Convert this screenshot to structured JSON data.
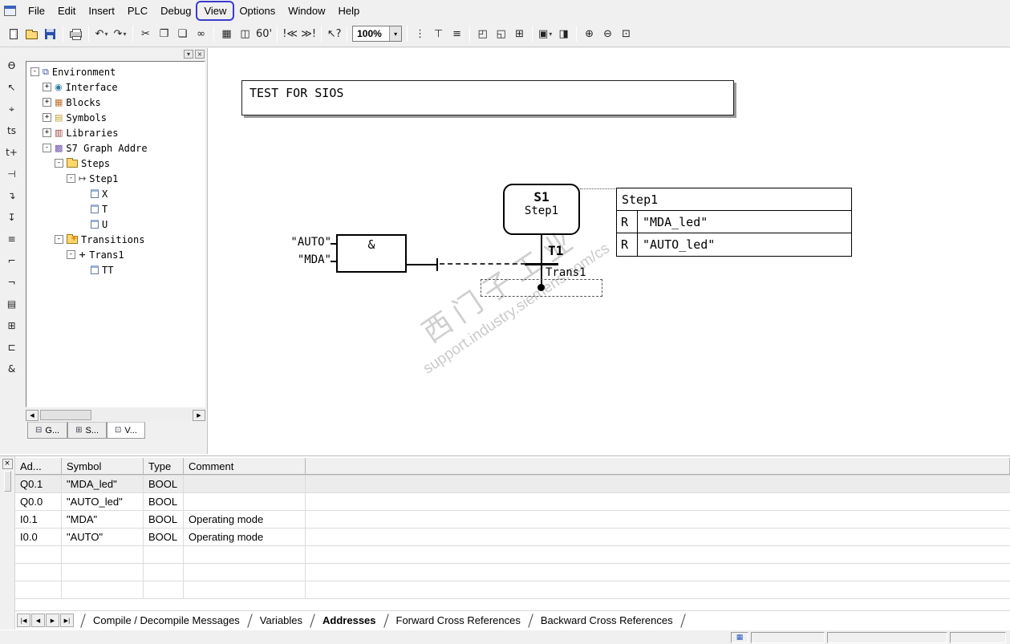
{
  "menu": {
    "items": [
      "File",
      "Edit",
      "Insert",
      "PLC",
      "Debug",
      "View",
      "Options",
      "Window",
      "Help"
    ]
  },
  "toolbar": {
    "dropdown": "▾",
    "undo": "↶",
    "redo": "↷",
    "cut": "✂",
    "copy": "❐",
    "paste": "❏",
    "find": "∞",
    "detail_view": "▦",
    "block_properties": "◫",
    "monitor_glasses": "60'",
    "prev_error": "!≪",
    "next_error": "≫!",
    "context_help": "↖?",
    "zoom_value": "100%",
    "sequence_view": "⋮",
    "single_step_view": "⊤",
    "overview": "≡",
    "show_symbols": "◰",
    "show_comments": "◱",
    "show_conditions": "⊞",
    "display_options": "▣",
    "display_bright": "◨",
    "zoom_in": "⊕",
    "zoom_out": "⊖",
    "zoom_fit": "⊡"
  },
  "left_toolbar": {
    "buttons": [
      "Ѳ",
      "↖",
      "⌖",
      "ts",
      "t+",
      "⊣",
      "↴",
      "↧",
      "≡",
      "⌐",
      "¬",
      "▤",
      "⊞",
      "⊏",
      "&"
    ]
  },
  "icons": {
    "environment": "⧉",
    "interface": "◉",
    "blocks": "▦",
    "symbols": "▤",
    "libraries": "▥",
    "s7graph": "▩",
    "step": "↦",
    "transition": "+"
  },
  "tree": {
    "controls": {
      "dropdown": "▾",
      "close": "×"
    },
    "items": [
      {
        "label": "Environment",
        "expander": "-"
      },
      {
        "label": "Interface",
        "expander": "+"
      },
      {
        "label": "Blocks",
        "expander": "+"
      },
      {
        "label": "Symbols",
        "expander": "+"
      },
      {
        "label": "Libraries",
        "expander": "+"
      },
      {
        "label": "S7 Graph Addre",
        "expander": "-"
      },
      {
        "label": "Steps",
        "expander": "-"
      },
      {
        "label": "Step1",
        "expander": "-"
      },
      {
        "label": "X",
        "expander": ""
      },
      {
        "label": "T",
        "expander": ""
      },
      {
        "label": "U",
        "expander": ""
      },
      {
        "label": "Transitions",
        "expander": "-",
        "badge": "+"
      },
      {
        "label": "Trans1",
        "expander": "-"
      },
      {
        "label": "TT",
        "expander": ""
      }
    ],
    "scroll": {
      "left": "◀",
      "right": "▶"
    },
    "tabs": [
      {
        "icon": "⊟",
        "label": "G..."
      },
      {
        "icon": "⊞",
        "label": "S..."
      },
      {
        "icon": "⊡",
        "label": "V..."
      }
    ]
  },
  "canvas": {
    "comment_box": "TEST FOR SIOS",
    "step": {
      "id": "S1",
      "name": "Step1"
    },
    "transition": {
      "id": "T1",
      "name": "Trans1"
    },
    "and_block": {
      "symbol": "&",
      "inputs": [
        "\"AUTO\"",
        "\"MDA\""
      ]
    },
    "action_table": {
      "title": "Step1",
      "actions": [
        {
          "op": "R",
          "operand": "\"MDA_led\""
        },
        {
          "op": "R",
          "operand": "\"AUTO_led\""
        }
      ]
    },
    "watermark": {
      "line1": "西门子工业",
      "line2": "support.industry.siemens.com/cs"
    }
  },
  "bottom_panel": {
    "close": "×",
    "table": {
      "columns": [
        "Ad...",
        "Symbol",
        "Type",
        "Comment"
      ],
      "rows": [
        [
          "Q0.1",
          "\"MDA_led\"",
          "BOOL",
          ""
        ],
        [
          "Q0.0",
          "\"AUTO_led\"",
          "BOOL",
          ""
        ],
        [
          "I0.1",
          "\"MDA\"",
          "BOOL",
          "Operating mode"
        ],
        [
          "I0.0",
          "\"AUTO\"",
          "BOOL",
          "Operating mode"
        ]
      ]
    },
    "nav": [
      "|◀",
      "◀",
      "▶",
      "▶|"
    ],
    "tabs": [
      {
        "label": "Compile / Decompile Messages"
      },
      {
        "label": "Variables"
      },
      {
        "label": "Addresses",
        "active": true
      },
      {
        "label": "Forward Cross References"
      },
      {
        "label": "Backward Cross References"
      }
    ]
  }
}
